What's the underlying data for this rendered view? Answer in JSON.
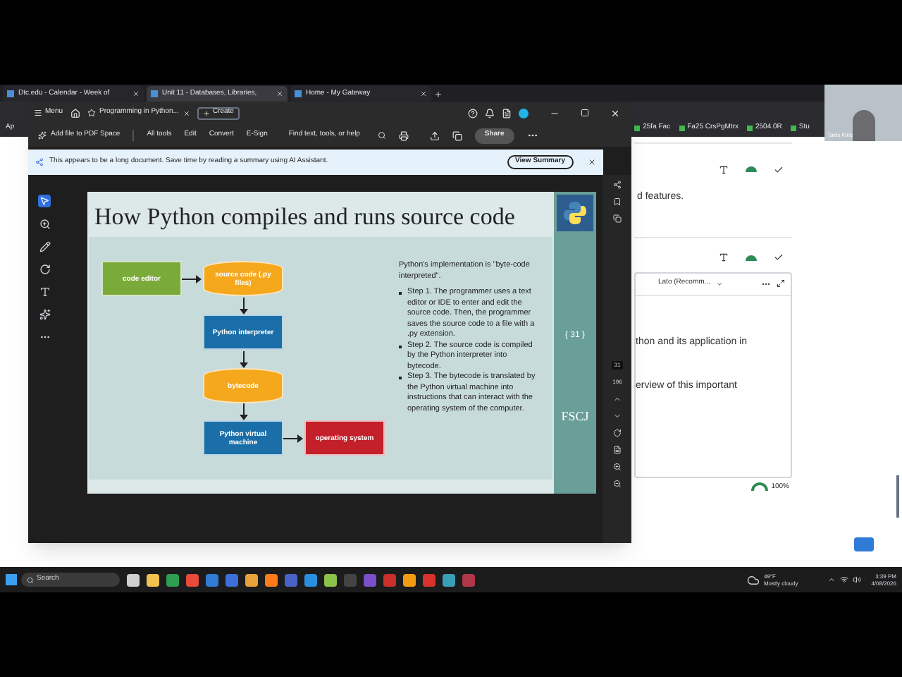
{
  "browser": {
    "tabs": [
      {
        "label": "Dtc.edu - Calendar - Week of",
        "selected": false
      },
      {
        "label": "Unit 11 - Databases, Libraries,",
        "selected": true
      },
      {
        "label": "Home - My Gateway",
        "selected": false
      }
    ],
    "apps_label": "Ap",
    "bookmarks": [
      "25fa Fac",
      "Fa25 CrsPgMtrx",
      "2504.0R",
      "Stu"
    ]
  },
  "video_tile": {
    "name": "Takis Kiris"
  },
  "acrobat": {
    "menu": "Menu",
    "tab": "Programming in Python...",
    "create": "Create",
    "add_file": "Add file to PDF Space",
    "tools": [
      "All tools",
      "Edit",
      "Convert",
      "E-Sign"
    ],
    "search": {
      "placeholder": "Find text, tools, or help"
    },
    "share": "Share",
    "banner": {
      "text": "This appears to be a long document. Save time by reading a summary using AI Assistant.",
      "button": "View Summary"
    },
    "page_number": "31",
    "page_count": "196"
  },
  "slide": {
    "title": "How Python compiles and runs source code",
    "nodes": [
      {
        "kind": "box",
        "label": "code editor",
        "color": "#7aab3a"
      },
      {
        "kind": "cylinder",
        "label": "source code (.py files)",
        "color": "#f5a81c"
      },
      {
        "kind": "box",
        "label": "Python interpreter",
        "color": "#1a6fa8"
      },
      {
        "kind": "cylinder",
        "label": "bytecode",
        "color": "#f5a81c"
      },
      {
        "kind": "box",
        "label": "Python virtual machine",
        "color": "#1a6fa8"
      },
      {
        "kind": "box",
        "label": "operating system",
        "color": "#c4202a"
      }
    ],
    "intro": "Python's implementation is \"byte-code interpreted\".",
    "steps": [
      "Step 1. The programmer uses a text editor or IDE to enter and edit the source code. Then, the programmer saves the source code to a file with a .py extension.",
      "Step 2. The source code is compiled by the Python interpreter into bytecode.",
      "Step 3. The bytecode is translated by the Python virtual machine into instructions that can interact with the operating system of the computer."
    ],
    "page_tag": "{ 31 }",
    "logo": "FSCJ"
  },
  "background_page": {
    "line_1": "d features.",
    "font_select": "Lato (Recomm...",
    "line_2": "thon and its application in",
    "line_3": "erview of this important",
    "zoom": "100%"
  },
  "taskbar": {
    "search": "Search",
    "temperature": "49°F",
    "condition": "Mostly cloudy",
    "time": "3:39 PM",
    "date": "4/08/2026"
  }
}
